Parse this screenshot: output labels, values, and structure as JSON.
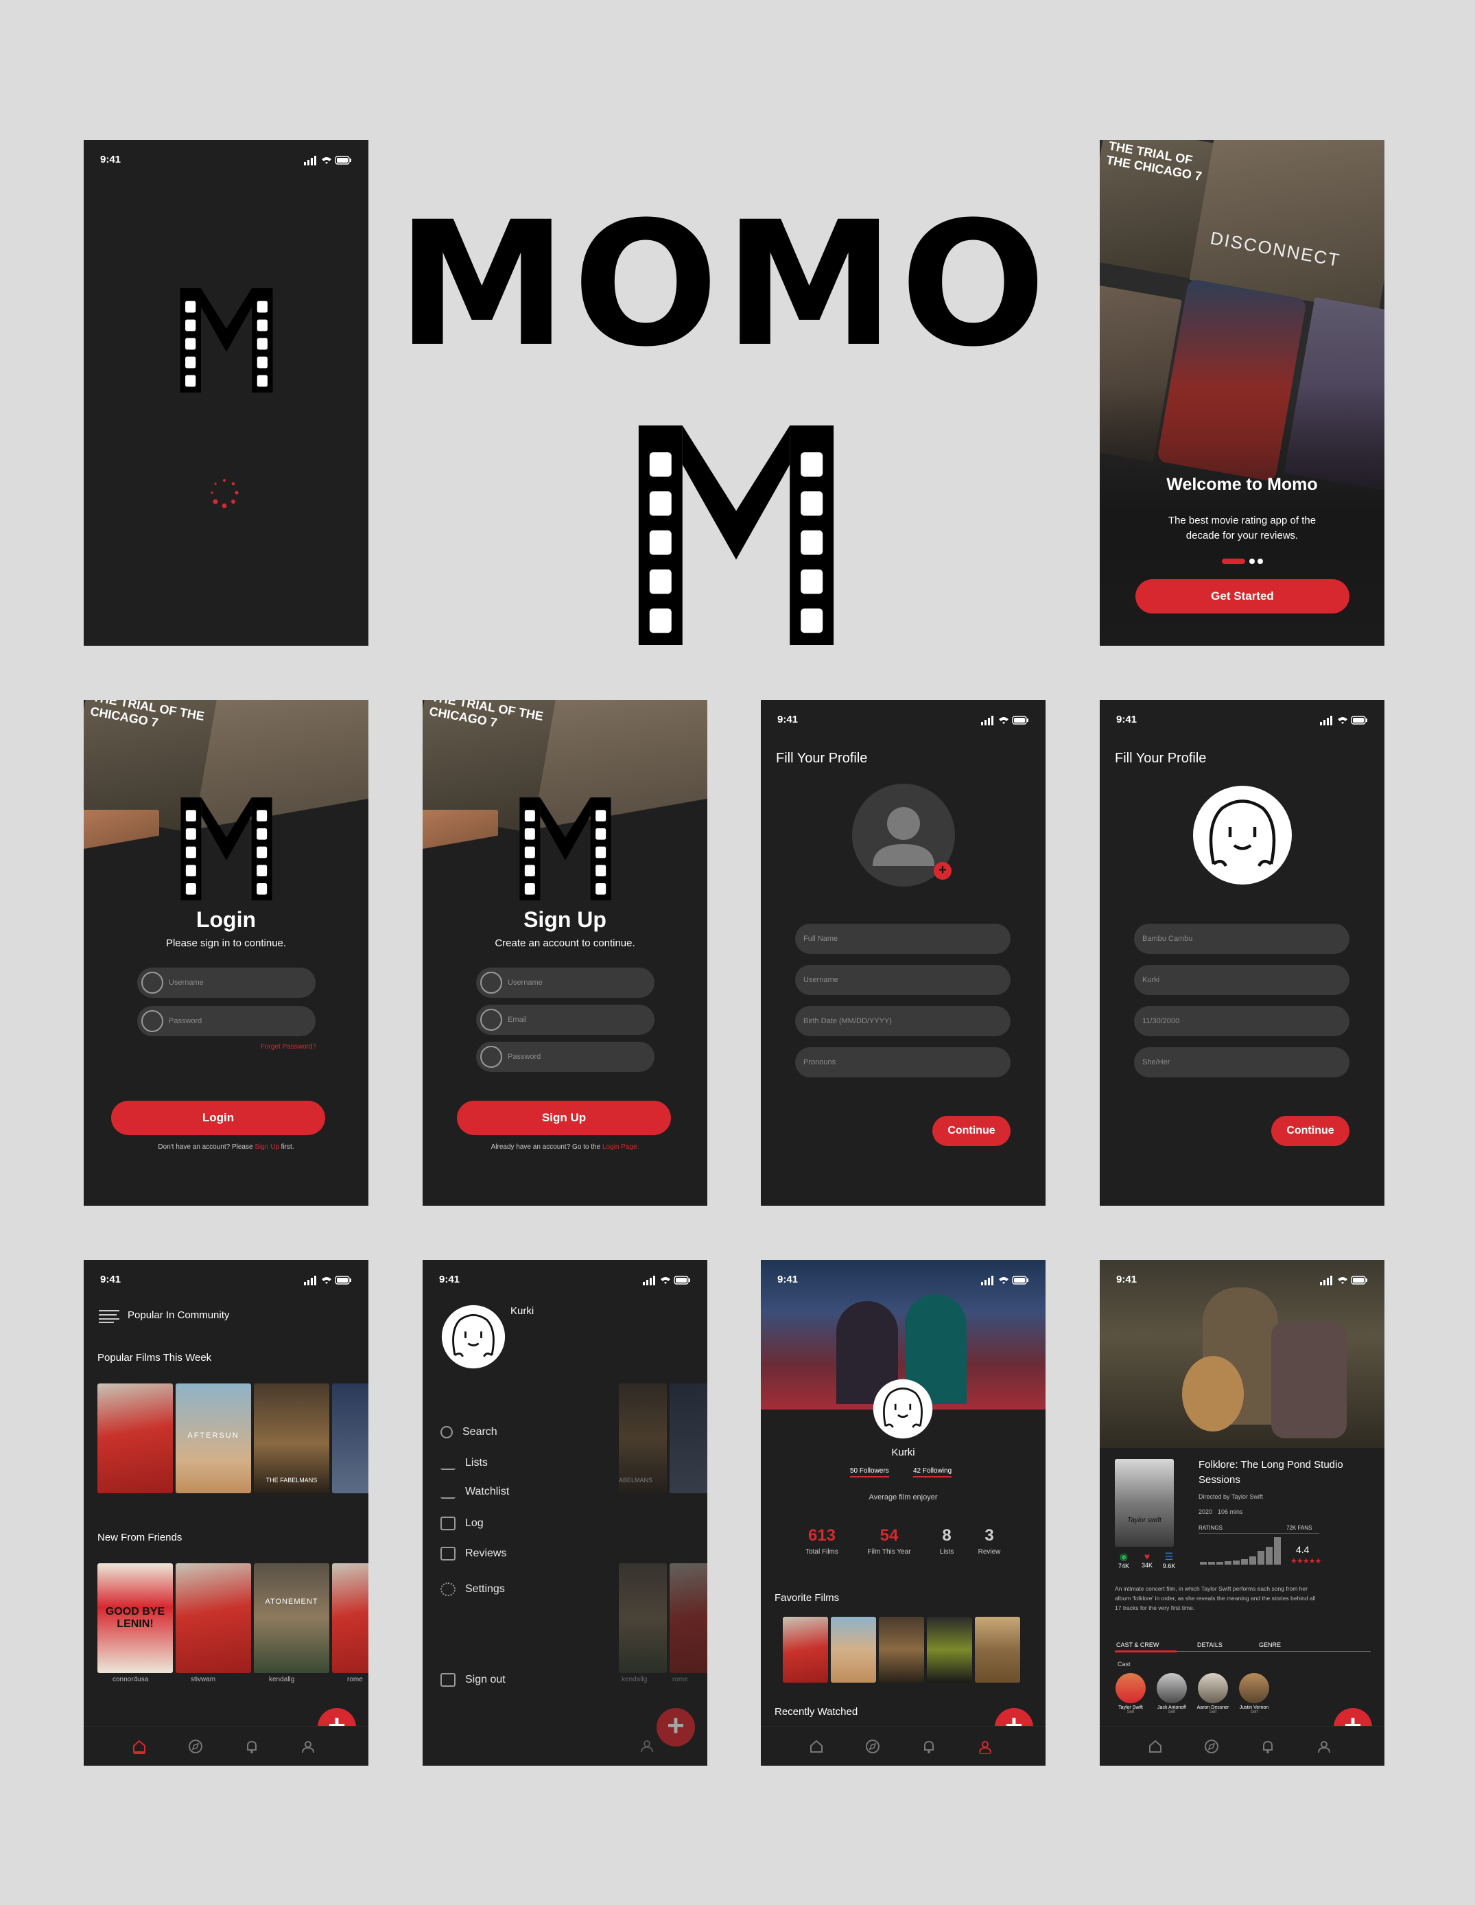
{
  "brand": {
    "name": "MOMO",
    "accent": "#d7282f",
    "bg": "#1f1f1f"
  },
  "status_time": "9:41",
  "onboarding": {
    "title": "Welcome to Momo",
    "subtitle_line1": "The best movie rating app of the",
    "subtitle_line2": "decade for your reviews.",
    "cta": "Get Started",
    "poster_text_1": "THE TRIAL OF THE CHICAGO 7",
    "poster_text_2": "DISCONNECT"
  },
  "login": {
    "title": "Login",
    "subtitle": "Please sign in to continue.",
    "username_placeholder": "Username",
    "password_placeholder": "Password",
    "forgot": "Forget Password?",
    "button": "Login",
    "footer_pre": "Don't have an account? Please ",
    "footer_link": "Sign Up",
    "footer_post": " first."
  },
  "signup": {
    "title": "Sign Up",
    "subtitle": "Create an account to continue.",
    "username_placeholder": "Username",
    "email_placeholder": "Email",
    "password_placeholder": "Password",
    "button": "Sign Up",
    "footer_pre": "Already have an account? Go to the ",
    "footer_link": "Login Page."
  },
  "profile_empty": {
    "title": "Fill Your Profile",
    "fields": [
      "Full Name",
      "Username",
      "Birth Date (MM/DD/YYYY)",
      "Pronouns"
    ],
    "button": "Continue"
  },
  "profile_filled": {
    "title": "Fill Your Profile",
    "fields": [
      "Bambu Cambu",
      "Kurki",
      "11/30/2000",
      "She/Her"
    ],
    "button": "Continue"
  },
  "home": {
    "header": "Popular In Community",
    "section1": "Popular Films This Week",
    "section2": "New From Friends",
    "friends": [
      "connor4usa",
      "stivwam",
      "kendallg",
      "rome"
    ],
    "poster_titles": [
      "AFTERSUN",
      "THE FABELMANS",
      "GOOD BYE LENIN!",
      "ATONEMENT"
    ]
  },
  "drawer": {
    "user": "Kurki",
    "items": [
      "Search",
      "Lists",
      "Watchlist",
      "Log",
      "Reviews",
      "Settings"
    ],
    "signout": "Sign out",
    "peek_labels": [
      "ABELMANS",
      "kendallg",
      "rome"
    ]
  },
  "profile": {
    "name": "Kurki",
    "followers": "50 Followers",
    "following": "42 Following",
    "bio": "Average film enjoyer",
    "stats": [
      {
        "n": "613",
        "l": "Total Films",
        "c": "#d7282f"
      },
      {
        "n": "54",
        "l": "Film This Year",
        "c": "#d7282f"
      },
      {
        "n": "8",
        "l": "Lists",
        "c": "#cfcfcf"
      },
      {
        "n": "3",
        "l": "Review",
        "c": "#cfcfcf"
      }
    ],
    "favorites_title": "Favorite Films",
    "recent_title": "Recently Watched"
  },
  "film": {
    "title_line1": "Folklore: The Long Pond Studio",
    "title_line2": "Sessions",
    "director": "Directed by Taylor Swift",
    "year": "2020",
    "runtime": "106 mins",
    "ratings_label": "RATINGS",
    "fans": "72K FANS",
    "rating": "4.4",
    "stats": [
      "74K",
      "34K",
      "9.6K"
    ],
    "desc_line1": "An intimate concert film, in which Taylor Swift performs each song from her",
    "desc_line2": "album 'folklore' in order, as she reveals the meaning and the stories behind all",
    "desc_line3": "17 tracks for the very first time.",
    "tabs": [
      "CAST & CREW",
      "DETAILS",
      "GENRE"
    ],
    "cast_label": "Cast",
    "cast": [
      {
        "name": "Taylor Swift",
        "role": "Self"
      },
      {
        "name": "Jack Antonoff",
        "role": "Self"
      },
      {
        "name": "Aaron Dessner",
        "role": "Self"
      },
      {
        "name": "Justin Vernon",
        "role": "Self"
      }
    ],
    "poster_text": "Taylor swift"
  }
}
